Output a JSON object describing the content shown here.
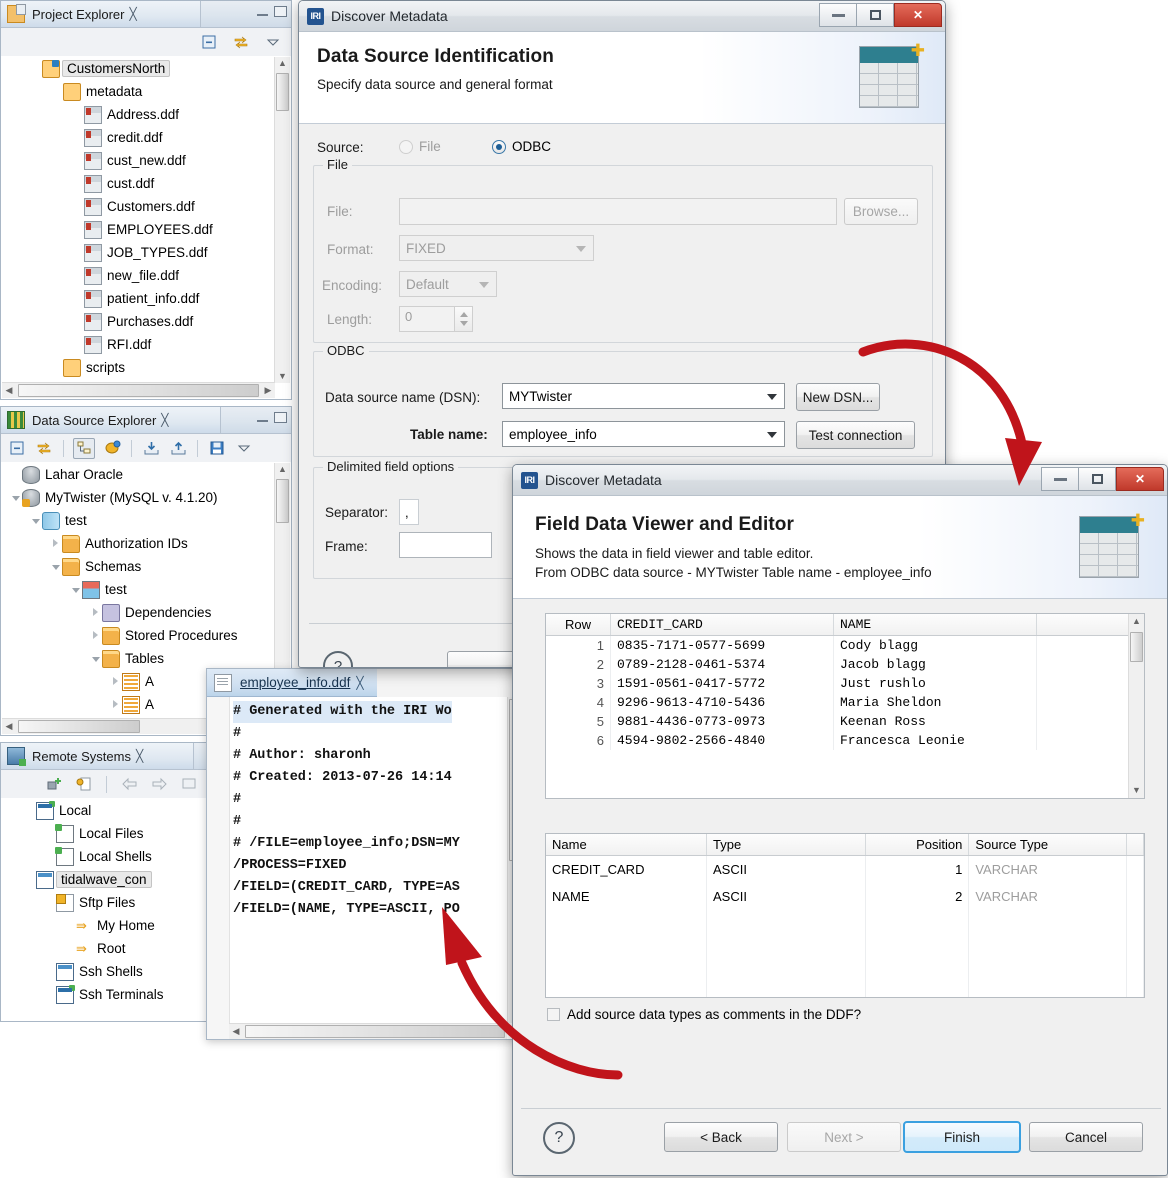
{
  "project_explorer": {
    "title": "Project Explorer",
    "tree": [
      {
        "label": "CustomersNorth",
        "icon": "project-icon",
        "indent": 0,
        "selected": true,
        "arrow": "none"
      },
      {
        "label": "metadata",
        "icon": "folder-open-icon",
        "indent": 1,
        "selected": false,
        "arrow": "none"
      },
      {
        "label": "Address.ddf",
        "icon": "ddf-file-icon",
        "indent": 2,
        "selected": false,
        "arrow": "none"
      },
      {
        "label": "credit.ddf",
        "icon": "ddf-file-icon",
        "indent": 2,
        "selected": false,
        "arrow": "none"
      },
      {
        "label": "cust_new.ddf",
        "icon": "ddf-file-icon",
        "indent": 2,
        "selected": false,
        "arrow": "none"
      },
      {
        "label": "cust.ddf",
        "icon": "ddf-file-icon",
        "indent": 2,
        "selected": false,
        "arrow": "none"
      },
      {
        "label": "Customers.ddf",
        "icon": "ddf-file-icon",
        "indent": 2,
        "selected": false,
        "arrow": "none"
      },
      {
        "label": "EMPLOYEES.ddf",
        "icon": "ddf-file-icon",
        "indent": 2,
        "selected": false,
        "arrow": "none"
      },
      {
        "label": "JOB_TYPES.ddf",
        "icon": "ddf-file-icon",
        "indent": 2,
        "selected": false,
        "arrow": "none"
      },
      {
        "label": "new_file.ddf",
        "icon": "ddf-file-icon",
        "indent": 2,
        "selected": false,
        "arrow": "none"
      },
      {
        "label": "patient_info.ddf",
        "icon": "ddf-file-icon",
        "indent": 2,
        "selected": false,
        "arrow": "none"
      },
      {
        "label": "Purchases.ddf",
        "icon": "ddf-file-icon",
        "indent": 2,
        "selected": false,
        "arrow": "none"
      },
      {
        "label": "RFI.ddf",
        "icon": "ddf-file-icon",
        "indent": 2,
        "selected": false,
        "arrow": "none"
      },
      {
        "label": "scripts",
        "icon": "folder-open-icon",
        "indent": 1,
        "selected": false,
        "arrow": "none"
      }
    ]
  },
  "data_source_explorer": {
    "title": "Data Source Explorer",
    "tree": [
      {
        "label": "Lahar Oracle",
        "icon": "database-icon",
        "indent": 0,
        "arrow": "none"
      },
      {
        "label": "MyTwister (MySQL v. 4.1.20)",
        "icon": "database-gold-icon",
        "indent": 0,
        "arrow": "open"
      },
      {
        "label": "test",
        "icon": "cylinder-icon",
        "indent": 1,
        "arrow": "open"
      },
      {
        "label": "Authorization IDs",
        "icon": "folder-icon",
        "indent": 2,
        "arrow": "closed"
      },
      {
        "label": "Schemas",
        "icon": "folder-icon",
        "indent": 2,
        "arrow": "open"
      },
      {
        "label": "test",
        "icon": "schema-icon",
        "indent": 3,
        "arrow": "open"
      },
      {
        "label": "Dependencies",
        "icon": "dependencies-icon",
        "indent": 4,
        "arrow": "closed"
      },
      {
        "label": "Stored Procedures",
        "icon": "folder-icon",
        "indent": 4,
        "arrow": "closed"
      },
      {
        "label": "Tables",
        "icon": "folder-icon",
        "indent": 4,
        "arrow": "open"
      },
      {
        "label": "A",
        "icon": "table-icon",
        "indent": 5,
        "arrow": "closed"
      },
      {
        "label": "A",
        "icon": "table-icon",
        "indent": 5,
        "arrow": "closed"
      }
    ]
  },
  "remote_systems": {
    "title": "Remote Systems",
    "tree": [
      {
        "label": "Local",
        "icon": "monitor-icon",
        "indent": 0,
        "selected": false
      },
      {
        "label": "Local Files",
        "icon": "local-files-icon",
        "indent": 1,
        "selected": false
      },
      {
        "label": "Local Shells",
        "icon": "local-shells-icon",
        "indent": 1,
        "selected": false
      },
      {
        "label": "tidalwave_con",
        "icon": "connection-icon",
        "indent": 0,
        "selected": true
      },
      {
        "label": "Sftp Files",
        "icon": "sftp-files-icon",
        "indent": 1,
        "selected": false
      },
      {
        "label": "My Home",
        "icon": "home-arrow-icon",
        "indent": 2,
        "selected": false
      },
      {
        "label": "Root",
        "icon": "root-arrow-icon",
        "indent": 2,
        "selected": false
      },
      {
        "label": "Ssh Shells",
        "icon": "ssh-shells-icon",
        "indent": 1,
        "selected": false
      },
      {
        "label": "Ssh Terminals",
        "icon": "ssh-terminals-icon",
        "indent": 1,
        "selected": false
      }
    ]
  },
  "editor": {
    "tab_label": "employee_info.ddf",
    "lines": [
      "# Generated with the IRI Wo",
      "#",
      "# Author: sharonh",
      "# Created: 2013-07-26 14:14",
      "#",
      "#",
      "# /FILE=employee_info;DSN=MY",
      "/PROCESS=FIXED",
      "/FIELD=(CREDIT_CARD, TYPE=AS",
      "/FIELD=(NAME, TYPE=ASCII, PO"
    ]
  },
  "dialog1": {
    "window_title": "Discover Metadata",
    "logo_text": "IRI",
    "banner_title": "Data Source Identification",
    "banner_subtitle": "Specify data source and general format",
    "source_label": "Source:",
    "radio_file": "File",
    "radio_odbc": "ODBC",
    "selected_source": "ODBC",
    "file_group": {
      "legend": "File",
      "file_label": "File:",
      "file_value": "",
      "browse_label": "Browse...",
      "format_label": "Format:",
      "format_value": "FIXED",
      "encoding_label": "Encoding:",
      "encoding_value": "Default",
      "length_label": "Length:",
      "length_value": "0"
    },
    "odbc_group": {
      "legend": "ODBC",
      "dsn_label": "Data source name (DSN):",
      "dsn_value": "MYTwister",
      "new_dsn_label": "New DSN...",
      "table_label": "Table name:",
      "table_value": "employee_info",
      "test_connection_label": "Test connection"
    },
    "delimited_group": {
      "legend": "Delimited field options",
      "separator_label": "Separator:",
      "separator_value": ",",
      "frame_label": "Frame:",
      "frame_value": ""
    }
  },
  "dialog2": {
    "window_title": "Discover Metadata",
    "logo_text": "IRI",
    "banner_title": "Field Data Viewer and Editor",
    "banner_line1": "Shows the data in field viewer and table editor.",
    "banner_line2": "From ODBC data source - MYTwister Table name - employee_info",
    "data_grid": {
      "columns": [
        "Row",
        "CREDIT_CARD",
        "NAME",
        ""
      ],
      "rows": [
        [
          "1",
          "0835-7171-0577-5699",
          "Cody blagg",
          ""
        ],
        [
          "2",
          "0789-2128-0461-5374",
          "Jacob blagg",
          ""
        ],
        [
          "3",
          "1591-0561-0417-5772",
          "Just rushlo",
          ""
        ],
        [
          "4",
          "9296-9613-4710-5436",
          "Maria Sheldon",
          ""
        ],
        [
          "5",
          "9881-4436-0773-0973",
          "Keenan Ross",
          ""
        ],
        [
          "6",
          "4594-9802-2566-4840",
          "Francesca Leonie",
          ""
        ]
      ]
    },
    "field_grid": {
      "columns": [
        "Name",
        "Type",
        "Position",
        "Source Type",
        ""
      ],
      "rows": [
        [
          "CREDIT_CARD",
          "ASCII",
          "1",
          "VARCHAR",
          ""
        ],
        [
          "NAME",
          "ASCII",
          "2",
          "VARCHAR",
          ""
        ]
      ],
      "empty_rows": 4
    },
    "checkbox_label": "Add source data types as comments in the DDF?",
    "checkbox_checked": false,
    "buttons": {
      "help": "?",
      "back": "< Back",
      "next": "Next >",
      "finish": "Finish",
      "cancel": "Cancel"
    }
  },
  "colors": {
    "accent": "#3aa0e0",
    "arrow_red": "#c0141b",
    "close_red": "#c0392b",
    "banner_teal": "#2e7f8f"
  }
}
